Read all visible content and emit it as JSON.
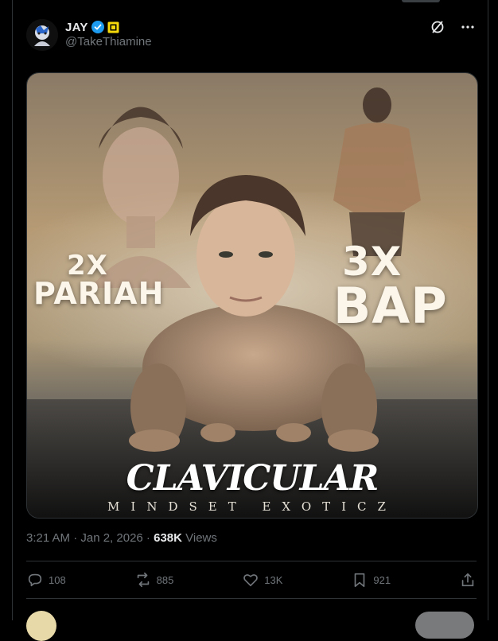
{
  "post": {
    "display_name": "JAY",
    "handle": "@TakeThiamine",
    "verified": true,
    "badge_icon": "affiliate-badge-icon",
    "timestamp": "3:21 AM · Jan 2, 2026 ·",
    "views_count": "638K",
    "views_label": "Views"
  },
  "media": {
    "left_top": "2X",
    "left_bottom": "PARIAH",
    "right_top": "3X",
    "right_bottom": "BAP",
    "title": "CLAVICULAR",
    "subtitle": "MINDSET EXOTICZ"
  },
  "actions": {
    "replies": "108",
    "reposts": "885",
    "likes": "13K",
    "bookmarks": "921"
  },
  "colors": {
    "background": "#000000",
    "text_primary": "#e7e9ea",
    "text_secondary": "#71767b",
    "verified_blue": "#1d9bf0",
    "badge_yellow": "#f5d90a",
    "border": "#2f3336"
  }
}
